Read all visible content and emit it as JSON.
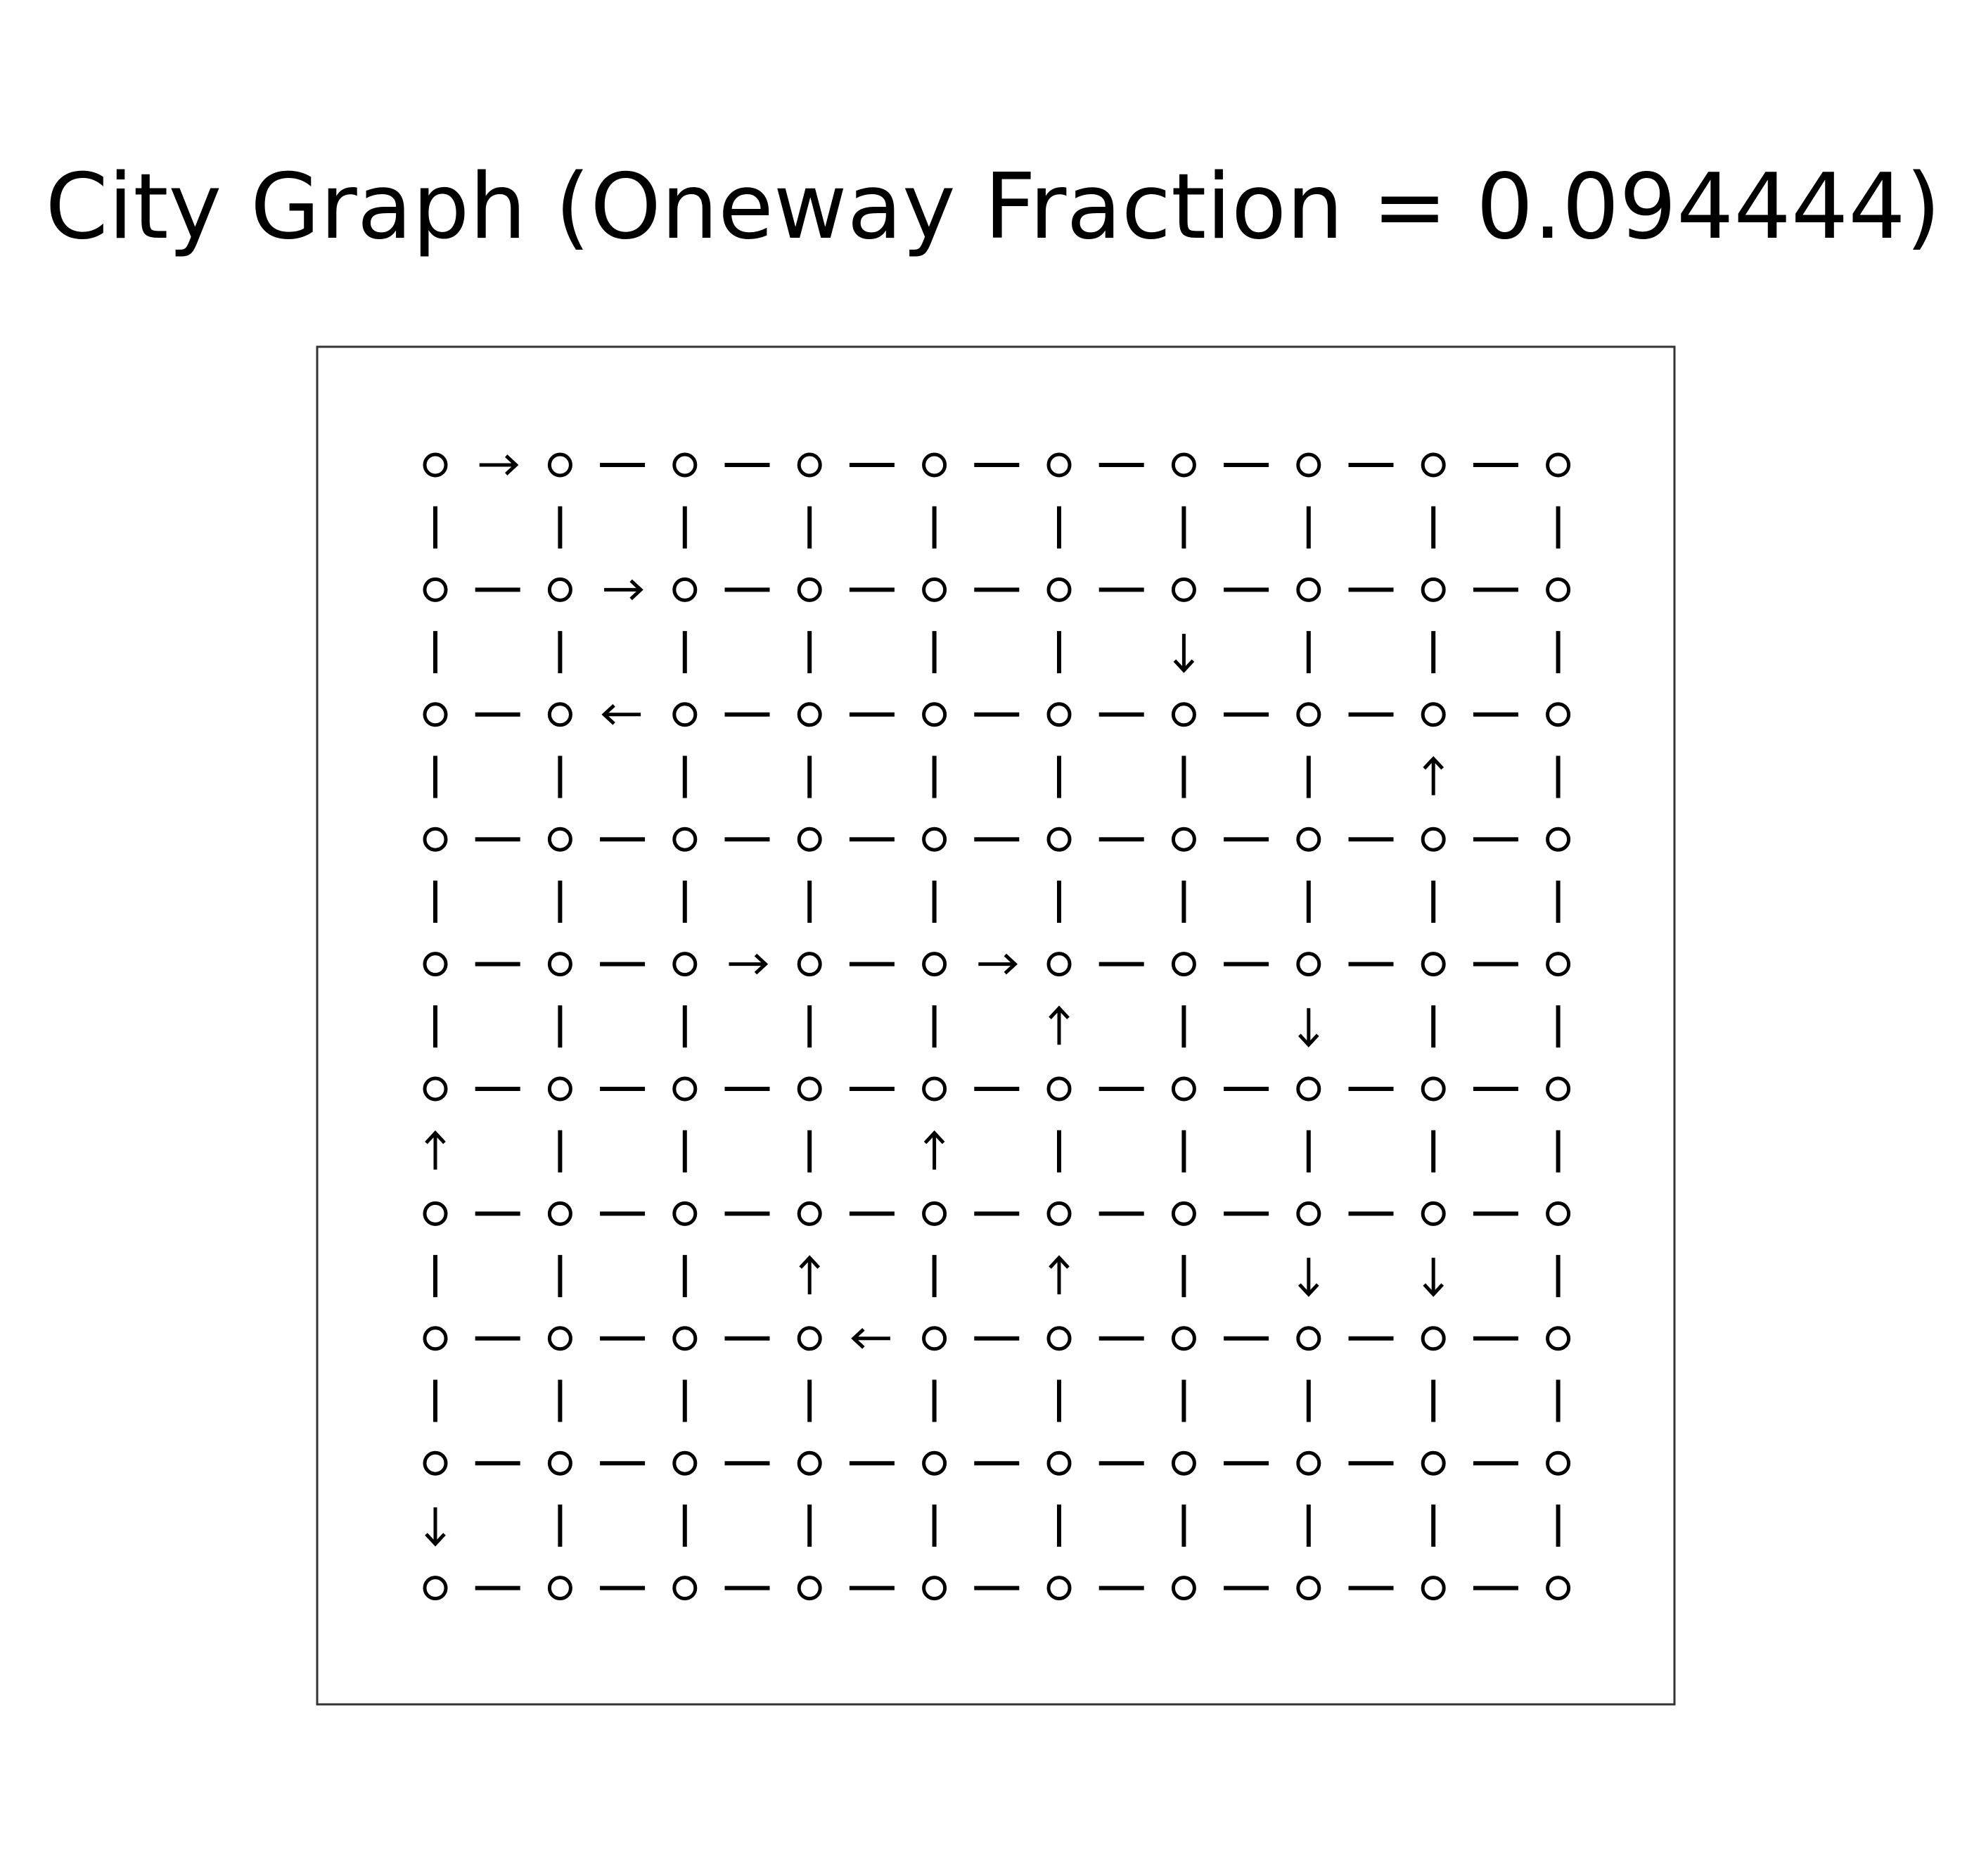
{
  "title": "City Graph (Oneway Fraction = 0.094444)",
  "colors": {
    "ink": "#000000",
    "background": "#ffffff",
    "frame": "#333333"
  },
  "graph": {
    "rows": 10,
    "cols": 10,
    "h_edges": [
      [
        "→",
        "—",
        "—",
        "—",
        "—",
        "—",
        "—",
        "—",
        "—"
      ],
      [
        "—",
        "→",
        "—",
        "—",
        "—",
        "—",
        "—",
        "—",
        "—"
      ],
      [
        "—",
        "←",
        "—",
        "—",
        "—",
        "—",
        "—",
        "—",
        "—"
      ],
      [
        "—",
        "—",
        "—",
        "—",
        "—",
        "—",
        "—",
        "—",
        "—"
      ],
      [
        "—",
        "—",
        "→",
        "—",
        "→",
        "—",
        "—",
        "—",
        "—"
      ],
      [
        "—",
        "—",
        "—",
        "—",
        "—",
        "—",
        "—",
        "—",
        "—"
      ],
      [
        "—",
        "—",
        "—",
        "—",
        "—",
        "—",
        "—",
        "—",
        "—"
      ],
      [
        "—",
        "—",
        "—",
        "←",
        "—",
        "—",
        "—",
        "—",
        "—"
      ],
      [
        "—",
        "—",
        "—",
        "—",
        "—",
        "—",
        "—",
        "—",
        "—"
      ],
      [
        "—",
        "—",
        "—",
        "—",
        "—",
        "—",
        "—",
        "—",
        "—"
      ]
    ],
    "v_edges": [
      [
        "|",
        "|",
        "|",
        "|",
        "|",
        "|",
        "|",
        "|",
        "|",
        "|"
      ],
      [
        "|",
        "|",
        "|",
        "|",
        "|",
        "|",
        "↓",
        "|",
        "|",
        "|"
      ],
      [
        "|",
        "|",
        "|",
        "|",
        "|",
        "|",
        "|",
        "|",
        "↑",
        "|"
      ],
      [
        "|",
        "|",
        "|",
        "|",
        "|",
        "|",
        "|",
        "|",
        "|",
        "|"
      ],
      [
        "|",
        "|",
        "|",
        "|",
        "|",
        "↑",
        "|",
        "↓",
        "|",
        "|"
      ],
      [
        "↑",
        "|",
        "|",
        "|",
        "↑",
        "|",
        "|",
        "|",
        "|",
        "|"
      ],
      [
        "|",
        "|",
        "|",
        "↑",
        "|",
        "↑",
        "|",
        "↓",
        "↓",
        "|"
      ],
      [
        "|",
        "|",
        "|",
        "|",
        "|",
        "|",
        "|",
        "|",
        "|",
        "|"
      ],
      [
        "↓",
        "|",
        "|",
        "|",
        "|",
        "|",
        "|",
        "|",
        "|",
        "|"
      ]
    ]
  }
}
